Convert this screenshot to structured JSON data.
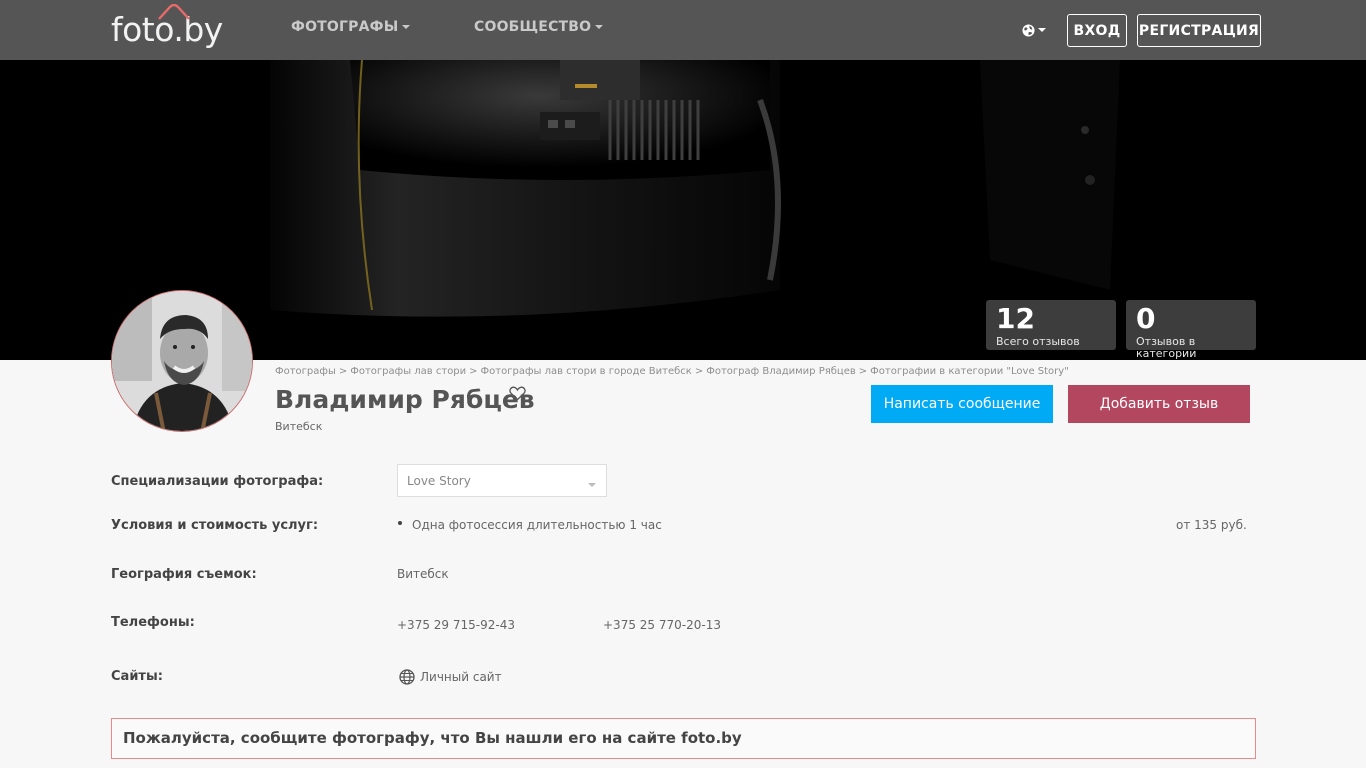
{
  "header": {
    "logo": "foto.by",
    "nav": [
      {
        "label": "ФОТОГРАФЫ"
      },
      {
        "label": "СООБЩЕСТВО"
      }
    ],
    "login_label": "ВХОД",
    "register_label": "РЕГИСТРАЦИЯ"
  },
  "stats": [
    {
      "value": "12",
      "label": "Всего отзывов"
    },
    {
      "value": "0",
      "label": "Отзывов в категории"
    }
  ],
  "breadcrumb": [
    "Фотографы",
    "Фотографы лав стори",
    "Фотографы лав стори в городе Витебск",
    "Фотограф Владимир Рябцев",
    "Фотографии в категории \"Love Story\""
  ],
  "breadcrumb_separator": ">",
  "profile": {
    "name": "Владимир Рябцев",
    "city": "Витебск",
    "message_button": "Написать сообщение",
    "review_button": "Добавить отзыв"
  },
  "details": {
    "specializations_label": "Специализации фотографа:",
    "specialization_selected": "Love Story",
    "services_label": "Условия и стоимость услуг:",
    "service_item": "Одна фотосессия длительностью 1 час",
    "service_price": "от 135 руб.",
    "geography_label": "География съемок:",
    "geography_value": "Витебск",
    "phones_label": "Телефоны:",
    "phones": [
      "+375 29 715-92-43",
      "+375 25 770-20-13"
    ],
    "sites_label": "Сайты:",
    "site_link": "Личный сайт"
  },
  "notice": "Пожалуйста, сообщите фотографу, что Вы нашли его на сайте foto.by",
  "colors": {
    "header_bg": "#555555",
    "message_button": "#00aaf5",
    "review_button": "#b2475f",
    "notice_border": "#e88a8a"
  }
}
